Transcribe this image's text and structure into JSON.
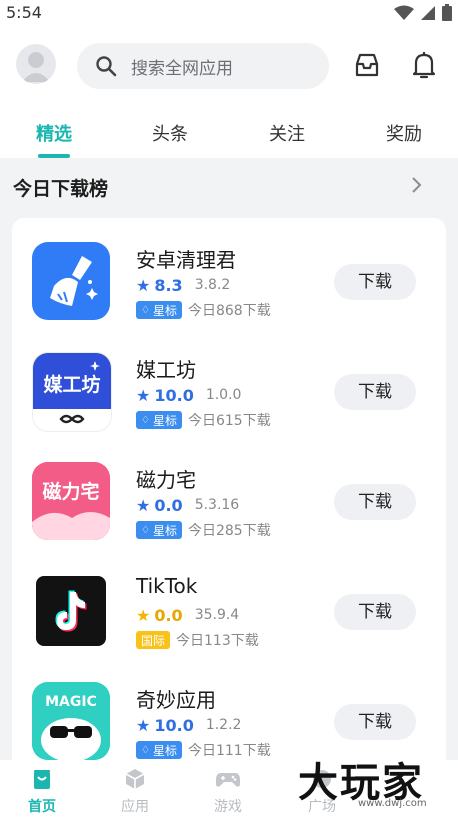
{
  "status_bar": {
    "time": "5:54"
  },
  "header": {
    "search_placeholder": "搜索全网应用"
  },
  "tabs": [
    {
      "label": "精选",
      "active": true
    },
    {
      "label": "头条",
      "active": false
    },
    {
      "label": "关注",
      "active": false
    },
    {
      "label": "奖励",
      "active": false
    }
  ],
  "section": {
    "title": "今日下载榜"
  },
  "apps": [
    {
      "name": "安卓清理君",
      "score": "8.3",
      "version": "3.8.2",
      "badge": "星标",
      "downloads": "今日868下载",
      "button": "下载",
      "icon": "broom-icon",
      "accent": "#2f7cf6"
    },
    {
      "name": "媒工坊",
      "score": "10.0",
      "version": "1.0.0",
      "badge": "星标",
      "downloads": "今日615下载",
      "button": "下载",
      "icon": "meigongfang-logo",
      "icon_text": "媒工坊",
      "accent": "#2f4fd8"
    },
    {
      "name": "磁力宅",
      "score": "0.0",
      "version": "5.3.16",
      "badge": "星标",
      "downloads": "今日285下载",
      "button": "下载",
      "icon": "cilizhai-logo",
      "icon_text": "磁力宅",
      "accent": "#f45a7e"
    },
    {
      "name": "TikTok",
      "score": "0.0",
      "version": "35.9.4",
      "badge": "国际",
      "downloads": "今日113下载",
      "button": "下载",
      "icon": "tiktok-icon",
      "accent": "#111111"
    },
    {
      "name": "奇妙应用",
      "score": "10.0",
      "version": "1.2.2",
      "badge": "星标",
      "downloads": "今日111下载",
      "button": "下载",
      "icon": "magic-icon",
      "icon_text": "MAGIC",
      "accent": "#2fcfc2"
    }
  ],
  "bottom_nav": [
    {
      "label": "首页",
      "active": true,
      "icon": "home-bag-icon"
    },
    {
      "label": "应用",
      "active": false,
      "icon": "cube-icon"
    },
    {
      "label": "游戏",
      "active": false,
      "icon": "gamepad-icon"
    },
    {
      "label": "广场",
      "active": false,
      "icon": "plaza-icon"
    }
  ],
  "watermark": {
    "text": "大玩家",
    "sub": "www.dwj.com"
  },
  "colors": {
    "accent": "#1bb6b0",
    "star_blue": "#2f6fe4",
    "badge_blue": "#3b8ef0",
    "badge_yellow": "#f8c21a"
  }
}
